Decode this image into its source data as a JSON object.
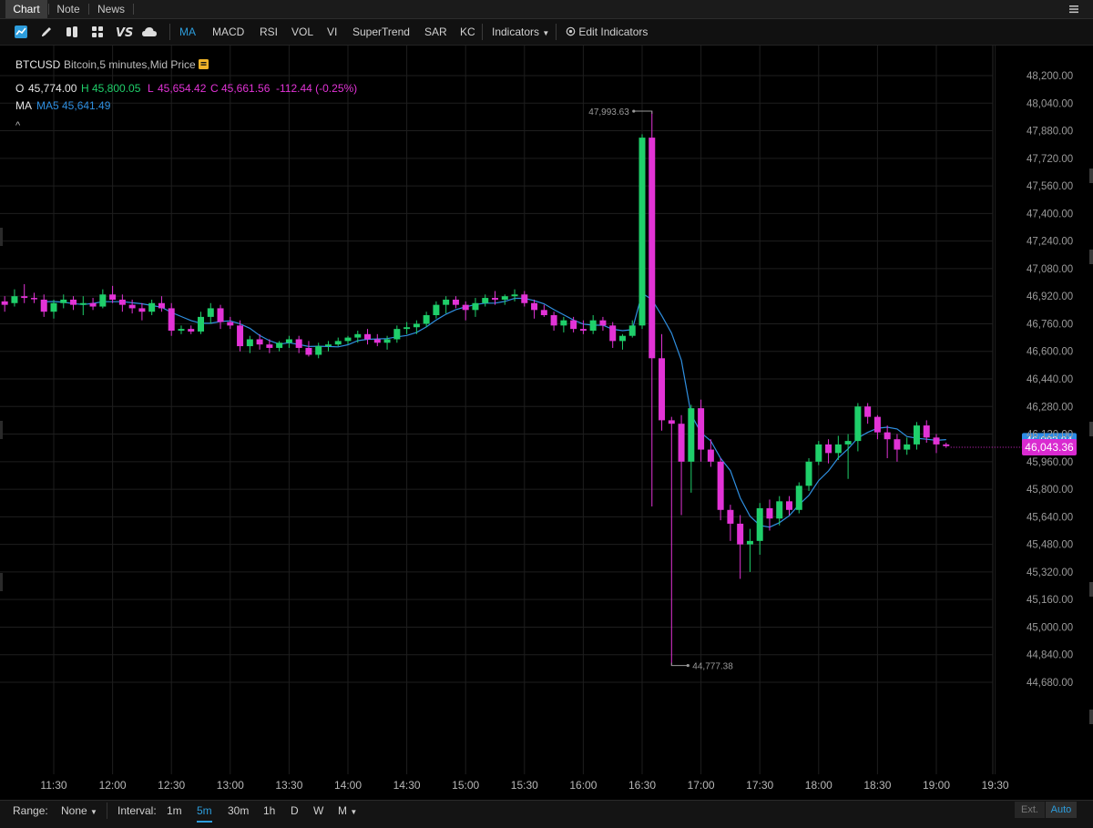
{
  "tabs": [
    {
      "label": "Chart",
      "active": true
    },
    {
      "label": "Note",
      "active": false
    },
    {
      "label": "News",
      "active": false
    }
  ],
  "toolbar": {
    "tool_icons": [
      "chart-style-icon",
      "drawing-pencil-icon",
      "flexible-grid-icon",
      "grid-layout-icon",
      "vs-compare-icon",
      "cloud-icon"
    ],
    "studies": [
      {
        "label": "MA",
        "active": true
      },
      {
        "label": "MACD",
        "active": false
      },
      {
        "label": "RSI",
        "active": false
      },
      {
        "label": "VOL",
        "active": false
      },
      {
        "label": "VI",
        "active": false
      },
      {
        "label": "SuperTrend",
        "active": false
      },
      {
        "label": "SAR",
        "active": false
      },
      {
        "label": "KC",
        "active": false
      }
    ],
    "indicators_label": "Indicators",
    "edit_indicators_label": "Edit Indicators"
  },
  "header": {
    "symbol": "BTCUSD",
    "description": "Bitcoin,5 minutes,Mid Price",
    "ohlc": {
      "o_label": "O",
      "o": "45,774.00",
      "h_label": "H",
      "h": "45,800.05",
      "l_label": "L",
      "l": "45,654.42",
      "c_label": "C",
      "c": "45,661.56",
      "change": "-112.44 (-0.25%)"
    },
    "ma_label": "MA",
    "ma_value_label": "MA5 45,641.49",
    "collapse_label": "^"
  },
  "bottom": {
    "range_label": "Range:",
    "range_value": "None",
    "interval_label": "Interval:",
    "intervals": [
      "1m",
      "5m",
      "30m",
      "1h",
      "D",
      "W",
      "M"
    ],
    "selected_interval": "5m",
    "ext_label": "Ext.",
    "auto_label": "Auto"
  },
  "colors": {
    "up": "#1fcf6a",
    "down": "#e233d6",
    "ma": "#2f8fe0",
    "grid": "#1e1e1e",
    "price_tag": "#d92ad0",
    "prev_tag": "#2d8ce6"
  },
  "chart_data": {
    "type": "candlestick",
    "x_tick_labels": [
      "11:30",
      "12:00",
      "12:30",
      "13:00",
      "13:30",
      "14:00",
      "14:30",
      "15:00",
      "15:30",
      "16:00",
      "16:30",
      "17:00",
      "17:30",
      "18:00",
      "18:30",
      "19:00",
      "19:30"
    ],
    "y_tick_labels": [
      "48,200.00",
      "48,040.00",
      "47,880.00",
      "47,720.00",
      "47,560.00",
      "47,400.00",
      "47,240.00",
      "47,080.00",
      "46,920.00",
      "46,760.00",
      "46,600.00",
      "46,440.00",
      "46,280.00",
      "46,120.00",
      "45,960.00",
      "45,800.00",
      "45,640.00",
      "45,480.00",
      "45,320.00",
      "45,160.00",
      "45,000.00",
      "44,840.00",
      "44,680.00"
    ],
    "ylim": [
      44600,
      48280
    ],
    "start_time": "11:05",
    "interval_minutes": 5,
    "series": [
      {
        "name": "BTCUSD",
        "candles": [
          [
            46890,
            46920,
            46830,
            46870
          ],
          [
            46880,
            46960,
            46860,
            46920
          ],
          [
            46920,
            46990,
            46880,
            46910
          ],
          [
            46910,
            46940,
            46880,
            46905
          ],
          [
            46900,
            46930,
            46800,
            46830
          ],
          [
            46830,
            46900,
            46790,
            46880
          ],
          [
            46880,
            46930,
            46850,
            46900
          ],
          [
            46900,
            46920,
            46840,
            46870
          ],
          [
            46870,
            46920,
            46810,
            46880
          ],
          [
            46880,
            46910,
            46840,
            46860
          ],
          [
            46860,
            46960,
            46850,
            46930
          ],
          [
            46930,
            46980,
            46880,
            46900
          ],
          [
            46900,
            46930,
            46830,
            46870
          ],
          [
            46870,
            46900,
            46820,
            46850
          ],
          [
            46850,
            46880,
            46780,
            46830
          ],
          [
            46830,
            46900,
            46810,
            46880
          ],
          [
            46880,
            46920,
            46830,
            46850
          ],
          [
            46850,
            46880,
            46690,
            46720
          ],
          [
            46720,
            46750,
            46700,
            46730
          ],
          [
            46730,
            46750,
            46700,
            46715
          ],
          [
            46715,
            46830,
            46700,
            46800
          ],
          [
            46800,
            46880,
            46760,
            46850
          ],
          [
            46850,
            46870,
            46730,
            46770
          ],
          [
            46770,
            46800,
            46730,
            46750
          ],
          [
            46750,
            46780,
            46600,
            46630
          ],
          [
            46630,
            46690,
            46590,
            46670
          ],
          [
            46670,
            46700,
            46610,
            46640
          ],
          [
            46640,
            46670,
            46590,
            46620
          ],
          [
            46620,
            46660,
            46600,
            46650
          ],
          [
            46650,
            46690,
            46620,
            46670
          ],
          [
            46670,
            46690,
            46590,
            46620
          ],
          [
            46620,
            46660,
            46570,
            46580
          ],
          [
            46580,
            46650,
            46560,
            46630
          ],
          [
            46630,
            46660,
            46600,
            46640
          ],
          [
            46640,
            46680,
            46630,
            46660
          ],
          [
            46660,
            46690,
            46640,
            46680
          ],
          [
            46680,
            46720,
            46650,
            46700
          ],
          [
            46700,
            46730,
            46640,
            46670
          ],
          [
            46670,
            46700,
            46630,
            46650
          ],
          [
            46650,
            46690,
            46610,
            46670
          ],
          [
            46670,
            46750,
            46650,
            46730
          ],
          [
            46730,
            46770,
            46700,
            46740
          ],
          [
            46740,
            46780,
            46700,
            46760
          ],
          [
            46760,
            46830,
            46740,
            46810
          ],
          [
            46810,
            46890,
            46790,
            46870
          ],
          [
            46870,
            46920,
            46820,
            46900
          ],
          [
            46900,
            46920,
            46850,
            46870
          ],
          [
            46870,
            46890,
            46780,
            46840
          ],
          [
            46840,
            46910,
            46800,
            46880
          ],
          [
            46880,
            46930,
            46860,
            46910
          ],
          [
            46910,
            46950,
            46870,
            46900
          ],
          [
            46900,
            46930,
            46870,
            46920
          ],
          [
            46920,
            46960,
            46890,
            46930
          ],
          [
            46930,
            46950,
            46860,
            46880
          ],
          [
            46880,
            46900,
            46790,
            46840
          ],
          [
            46840,
            46870,
            46800,
            46810
          ],
          [
            46810,
            46830,
            46720,
            46750
          ],
          [
            46750,
            46800,
            46710,
            46780
          ],
          [
            46780,
            46800,
            46710,
            46730
          ],
          [
            46730,
            46780,
            46700,
            46720
          ],
          [
            46720,
            46810,
            46700,
            46780
          ],
          [
            46780,
            46800,
            46720,
            46750
          ],
          [
            46750,
            46770,
            46620,
            46660
          ],
          [
            46660,
            46700,
            46610,
            46690
          ],
          [
            46690,
            46780,
            46680,
            46750
          ],
          [
            46750,
            47860,
            46730,
            47840
          ],
          [
            47840,
            47993.63,
            45700,
            46560
          ],
          [
            46560,
            46700,
            46140,
            46200
          ],
          [
            46200,
            46220,
            44777.38,
            46180
          ],
          [
            46180,
            46230,
            45650,
            45960
          ],
          [
            45960,
            46290,
            45780,
            46270
          ],
          [
            46270,
            46320,
            45960,
            46030
          ],
          [
            46030,
            46090,
            45930,
            45960
          ],
          [
            45960,
            45980,
            45620,
            45680
          ],
          [
            45680,
            45710,
            45500,
            45600
          ],
          [
            45600,
            45650,
            45280,
            45480
          ],
          [
            45480,
            45570,
            45320,
            45500
          ],
          [
            45500,
            45720,
            45420,
            45690
          ],
          [
            45690,
            45740,
            45560,
            45630
          ],
          [
            45630,
            45760,
            45590,
            45730
          ],
          [
            45730,
            45760,
            45650,
            45680
          ],
          [
            45680,
            45840,
            45660,
            45820
          ],
          [
            45820,
            45980,
            45790,
            45960
          ],
          [
            45960,
            46080,
            45940,
            46060
          ],
          [
            46060,
            46090,
            45950,
            46010
          ],
          [
            46010,
            46110,
            45970,
            46060
          ],
          [
            46060,
            46120,
            45860,
            46080
          ],
          [
            46080,
            46300,
            46020,
            46280
          ],
          [
            46280,
            46300,
            46180,
            46220
          ],
          [
            46220,
            46230,
            46090,
            46130
          ],
          [
            46130,
            46170,
            45980,
            46090
          ],
          [
            46090,
            46120,
            45960,
            46030
          ],
          [
            46030,
            46100,
            46000,
            46060
          ],
          [
            46060,
            46190,
            46030,
            46170
          ],
          [
            46170,
            46200,
            46070,
            46100
          ],
          [
            46100,
            46120,
            46010,
            46060
          ],
          [
            46060,
            46070,
            46040,
            46050
          ]
        ]
      }
    ],
    "ma": {
      "name": "MA5",
      "period": 5
    },
    "annotations": [
      {
        "label": "47,993.63",
        "value": 47993.63
      },
      {
        "label": "44,777.38",
        "value": 44777.38
      }
    ],
    "price_tags": [
      {
        "label": "46,083.84",
        "value": 46083.84
      },
      {
        "label": "46,043.36",
        "value": 46043.36
      }
    ],
    "grid": true
  }
}
